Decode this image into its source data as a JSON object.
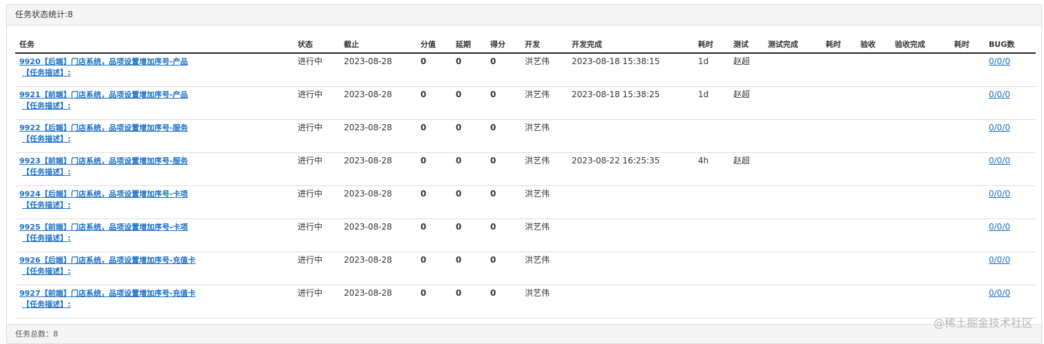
{
  "panel": {
    "title": "任务状态统计:8",
    "footer": "任务总数：8"
  },
  "table": {
    "columns": [
      "任务",
      "状态",
      "截止",
      "分值",
      "延期",
      "得分",
      "开发",
      "开发完成",
      "耗时",
      "测试",
      "测试完成",
      "耗时",
      "验收",
      "验收完成",
      "耗时",
      "BUG数"
    ],
    "rows": [
      {
        "task": "9920【后端】门店系统，品项设置增加序号-产品",
        "desc": "【任务描述】:",
        "status": "进行中",
        "deadline": "2023-08-28",
        "score_value": "0",
        "delay": "0",
        "score": "0",
        "dev": "洪艺伟",
        "dev_done": "2023-08-18 15:38:15",
        "dev_time": "1d",
        "tester": "赵超",
        "test_done": "",
        "test_time": "",
        "acceptor": "",
        "accept_done": "",
        "accept_time": "",
        "bugs": "0/0/0"
      },
      {
        "task": "9921【前端】门店系统，品项设置增加序号-产品",
        "desc": "【任务描述】:",
        "status": "进行中",
        "deadline": "2023-08-28",
        "score_value": "0",
        "delay": "0",
        "score": "0",
        "dev": "洪艺伟",
        "dev_done": "2023-08-18 15:38:25",
        "dev_time": "1d",
        "tester": "赵超",
        "test_done": "",
        "test_time": "",
        "acceptor": "",
        "accept_done": "",
        "accept_time": "",
        "bugs": "0/0/0"
      },
      {
        "task": "9922【后端】门店系统，品项设置增加序号-服务",
        "desc": "【任务描述】:",
        "status": "进行中",
        "deadline": "2023-08-28",
        "score_value": "0",
        "delay": "0",
        "score": "0",
        "dev": "洪艺伟",
        "dev_done": "",
        "dev_time": "",
        "tester": "",
        "test_done": "",
        "test_time": "",
        "acceptor": "",
        "accept_done": "",
        "accept_time": "",
        "bugs": "0/0/0"
      },
      {
        "task": "9923【前端】门店系统，品项设置增加序号-服务",
        "desc": "【任务描述】:",
        "status": "进行中",
        "deadline": "2023-08-28",
        "score_value": "0",
        "delay": "0",
        "score": "0",
        "dev": "洪艺伟",
        "dev_done": "2023-08-22 16:25:35",
        "dev_time": "4h",
        "tester": "赵超",
        "test_done": "",
        "test_time": "",
        "acceptor": "",
        "accept_done": "",
        "accept_time": "",
        "bugs": "0/0/0"
      },
      {
        "task": "9924【后端】门店系统，品项设置增加序号-卡项",
        "desc": "【任务描述】:",
        "status": "进行中",
        "deadline": "2023-08-28",
        "score_value": "0",
        "delay": "0",
        "score": "0",
        "dev": "洪艺伟",
        "dev_done": "",
        "dev_time": "",
        "tester": "",
        "test_done": "",
        "test_time": "",
        "acceptor": "",
        "accept_done": "",
        "accept_time": "",
        "bugs": "0/0/0"
      },
      {
        "task": "9925【前端】门店系统，品项设置增加序号-卡项",
        "desc": "【任务描述】:",
        "status": "进行中",
        "deadline": "2023-08-28",
        "score_value": "0",
        "delay": "0",
        "score": "0",
        "dev": "洪艺伟",
        "dev_done": "",
        "dev_time": "",
        "tester": "",
        "test_done": "",
        "test_time": "",
        "acceptor": "",
        "accept_done": "",
        "accept_time": "",
        "bugs": "0/0/0"
      },
      {
        "task": "9926【后端】门店系统，品项设置增加序号-充值卡",
        "desc": "【任务描述】:",
        "status": "进行中",
        "deadline": "2023-08-28",
        "score_value": "0",
        "delay": "0",
        "score": "0",
        "dev": "洪艺伟",
        "dev_done": "",
        "dev_time": "",
        "tester": "",
        "test_done": "",
        "test_time": "",
        "acceptor": "",
        "accept_done": "",
        "accept_time": "",
        "bugs": "0/0/0"
      },
      {
        "task": "9927【前端】门店系统，品项设置增加序号-充值卡",
        "desc": "【任务描述】:",
        "status": "进行中",
        "deadline": "2023-08-28",
        "score_value": "0",
        "delay": "0",
        "score": "0",
        "dev": "洪艺伟",
        "dev_done": "",
        "dev_time": "",
        "tester": "",
        "test_done": "",
        "test_time": "",
        "acceptor": "",
        "accept_done": "",
        "accept_time": "",
        "bugs": "0/0/0"
      }
    ]
  },
  "watermark": "@稀土掘金技术社区",
  "colors": {
    "link": "#1a6fc9",
    "panel_bg": "#f5f5f5",
    "border": "#dddddd"
  }
}
